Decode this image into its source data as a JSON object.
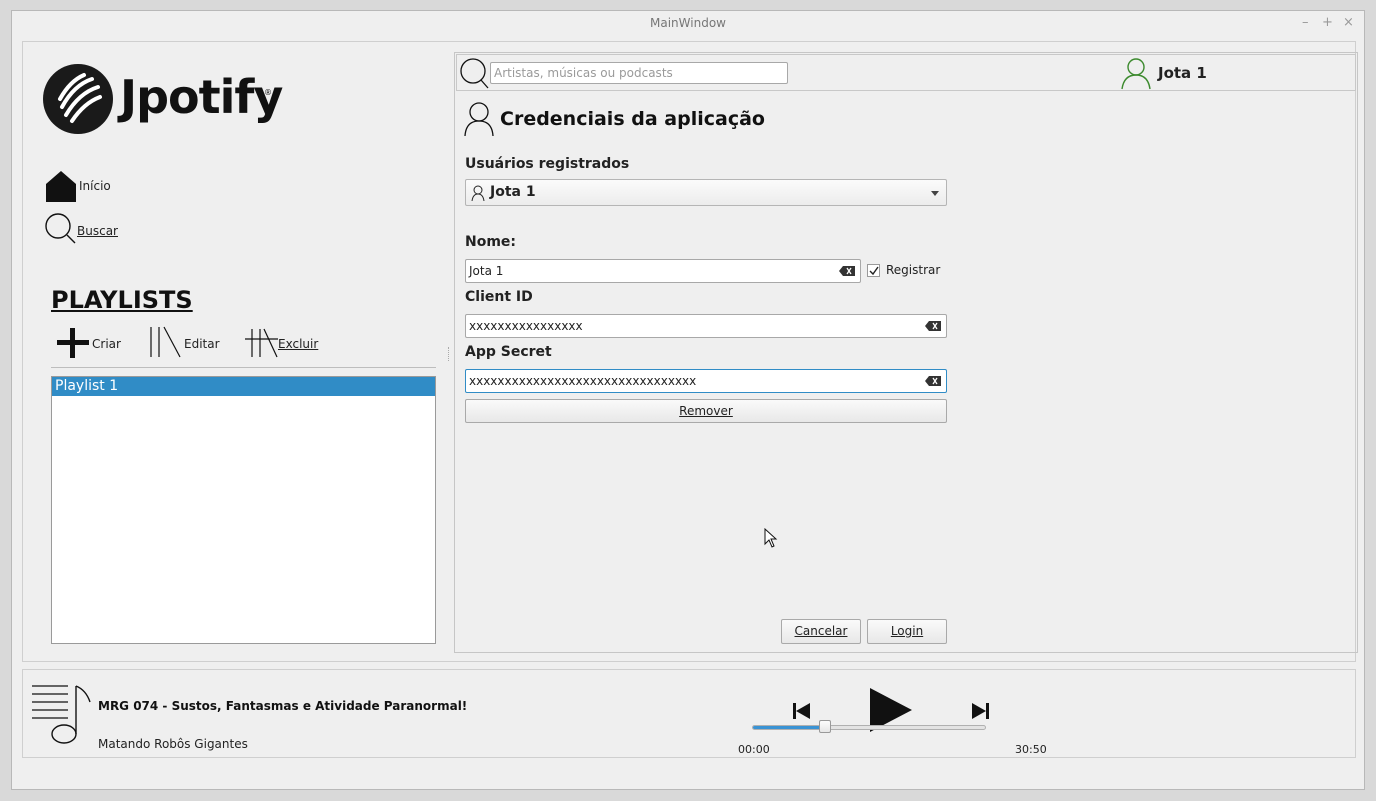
{
  "window": {
    "title": "MainWindow",
    "controls": {
      "minimize": "–",
      "maximize": "+",
      "close": "×"
    }
  },
  "brand": {
    "name": "Jpotify",
    "registered": "®"
  },
  "nav": {
    "home_label": "Início",
    "search_label": "Buscar"
  },
  "playlists": {
    "heading": "PLAYLISTS",
    "create_label": "Criar",
    "edit_label": "Editar",
    "delete_label": "Excluir",
    "items": [
      "Playlist 1"
    ]
  },
  "topbar": {
    "search_placeholder": "Artistas, músicas ou podcasts",
    "user_name": "Jota 1"
  },
  "credentials": {
    "title": "Credenciais da aplicação",
    "registered_users_label": "Usuários registrados",
    "selected_user": "Jota 1",
    "name_label": "Nome:",
    "name_value": "Jota 1",
    "register_label": "Registrar",
    "register_checked": true,
    "client_id_label": "Client ID",
    "client_id_value": "xxxxxxxxxxxxxxxx",
    "app_secret_label": "App Secret",
    "app_secret_value": "xxxxxxxxxxxxxxxxxxxxxxxxxxxxxxxx",
    "remove_label": "Remover",
    "cancel_label": "Cancelar",
    "login_label": "Login"
  },
  "player": {
    "track_title": "MRG 074 - Sustos, Fantasmas e Atividade Paranormal!",
    "artist": "Matando Robôs Gigantes",
    "elapsed": "00:00",
    "duration": "30:50",
    "progress_fraction": 0.31
  },
  "colors": {
    "accent": "#308cc6",
    "progress": "#3a93d4",
    "user_icon": "#3c8a2e"
  }
}
